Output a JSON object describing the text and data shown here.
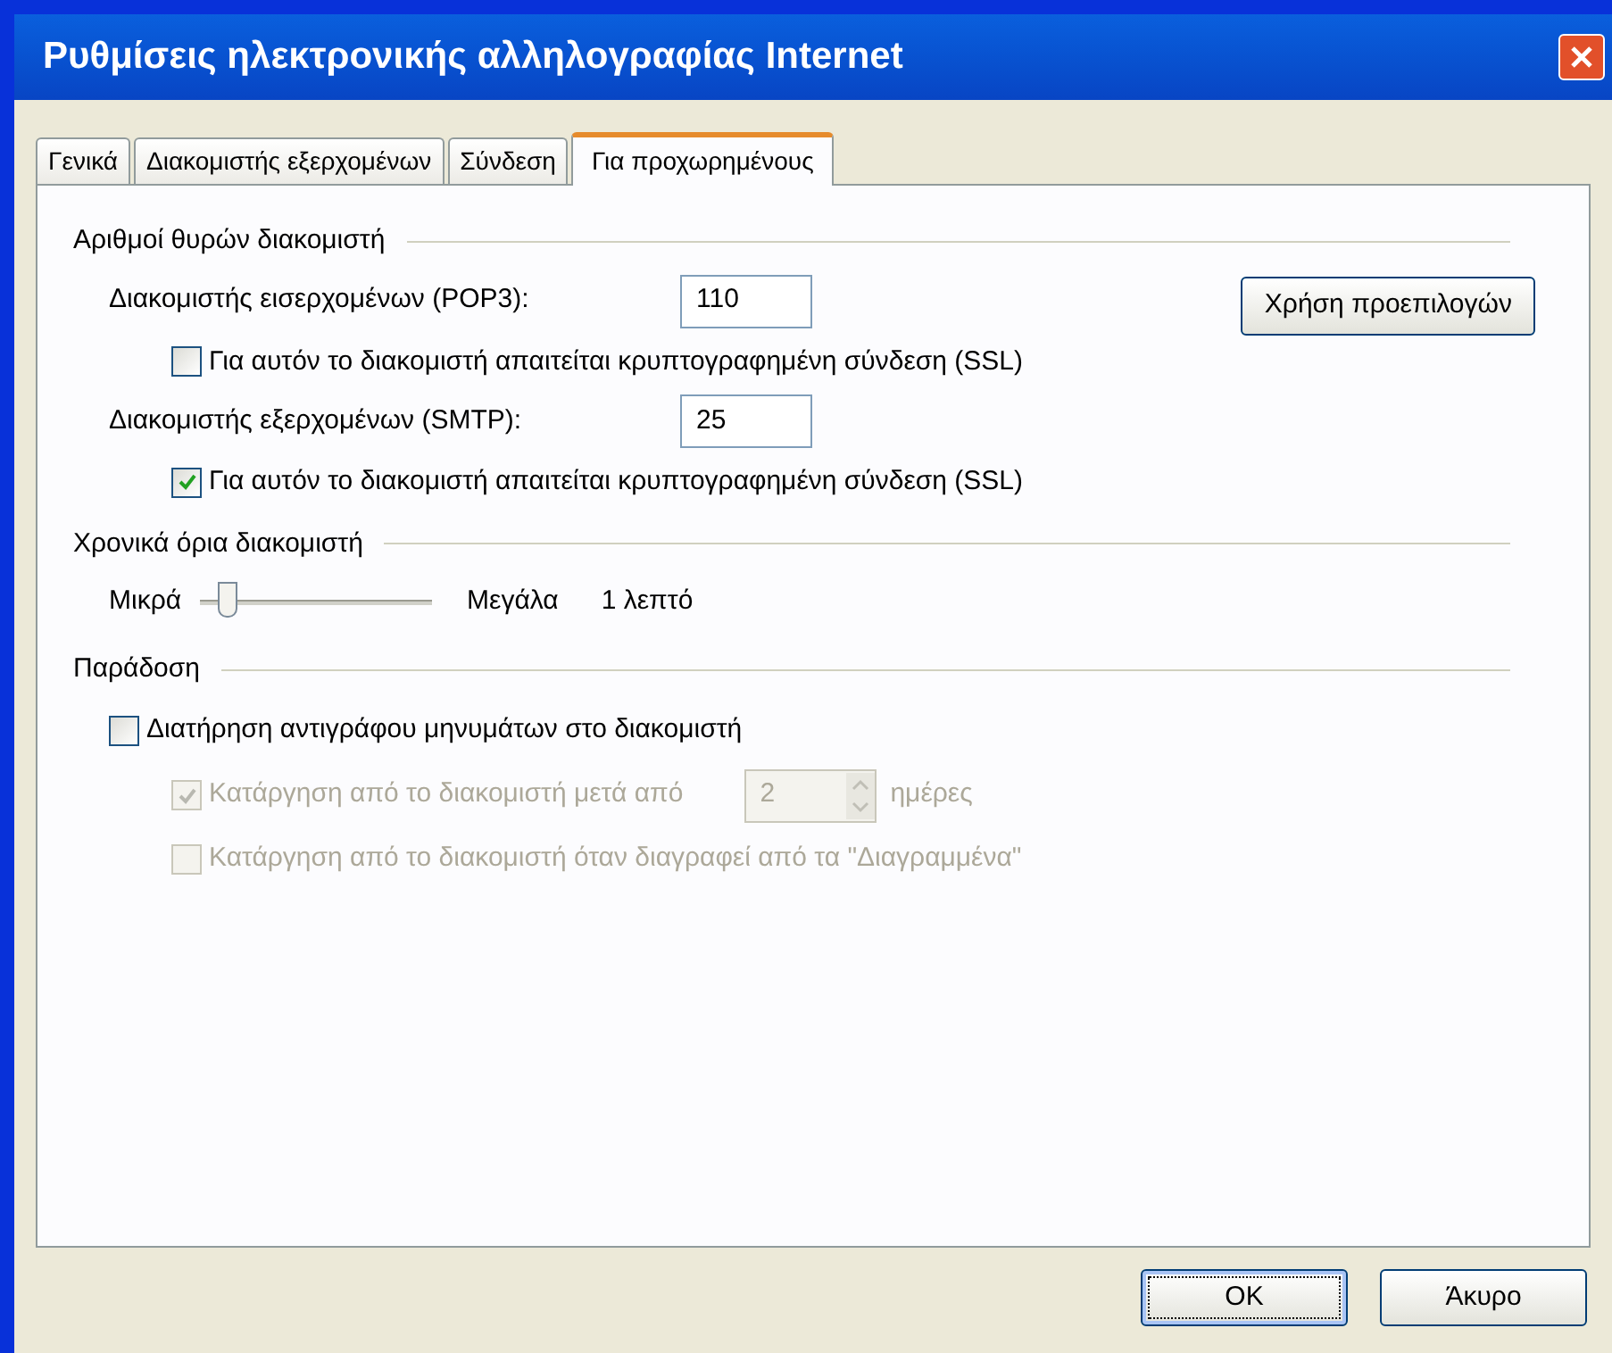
{
  "window": {
    "title": "Ρυθμίσεις ηλεκτρονικής αλληλογραφίας Internet"
  },
  "tabs": [
    {
      "label": "Γενικά",
      "selected": false
    },
    {
      "label": "Διακομιστής εξερχομένων",
      "selected": false
    },
    {
      "label": "Σύνδεση",
      "selected": false
    },
    {
      "label": "Για προχωρημένους",
      "selected": true
    }
  ],
  "ports": {
    "title": "Αριθμοί θυρών διακομιστή",
    "defaults_button": "Χρήση προεπιλογών",
    "servers": [
      {
        "label": "Διακομιστής εισερχομένων (POP3):",
        "value": "110",
        "ssl": {
          "label": "Για αυτόν το διακομιστή απαιτείται κρυπτογραφημένη σύνδεση (SSL)",
          "checked": false
        }
      },
      {
        "label": "Διακομιστής εξερχομένων (SMTP):",
        "value": "25",
        "ssl": {
          "label": "Για αυτόν το διακομιστή απαιτείται κρυπτογραφημένη σύνδεση (SSL)",
          "checked": true
        }
      }
    ]
  },
  "timeouts": {
    "title": "Χρονικά όρια διακομιστή",
    "min_label": "Μικρά",
    "max_label": "Μεγάλα",
    "level": 0.12,
    "reading": "1 λεπτό"
  },
  "delivery": {
    "title": "Παράδοση",
    "keep_copy": {
      "label": "Διατήρηση αντιγράφου μηνυμάτων στο διακομιστή",
      "checked": false,
      "disabled": false
    },
    "remove_after": {
      "label": "Κατάργηση από το διακομιστή μετά από",
      "checked": true,
      "disabled": true,
      "value": "2",
      "unit": "ημέρες"
    },
    "remove_deleted": {
      "label": "Κατάργηση από το διακομιστή όταν διαγραφεί από τα \"Διαγραμμένα\"",
      "checked": false,
      "disabled": true
    }
  },
  "buttons": [
    {
      "label": "OK",
      "selected": true
    },
    {
      "label": "Άκυρο",
      "selected": false
    }
  ]
}
